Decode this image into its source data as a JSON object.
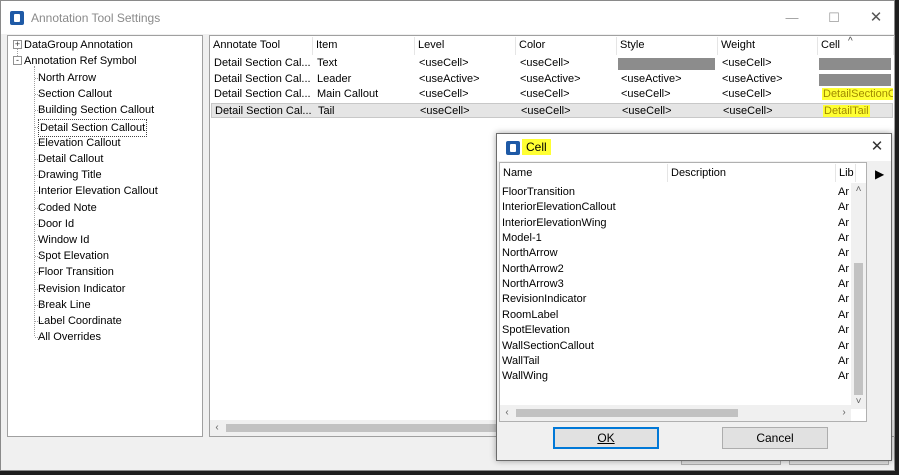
{
  "window": {
    "title": "Annotation Tool Settings"
  },
  "tree": {
    "root_items": [
      {
        "label": "DataGroup Annotation",
        "expander": "+"
      },
      {
        "label": "Annotation Ref Symbol",
        "expander": "-"
      }
    ],
    "children": [
      "North Arrow",
      "Section Callout",
      "Building Section Callout",
      "Detail Section Callout",
      "Elevation Callout",
      "Detail Callout",
      "Drawing Title",
      "Interior Elevation Callout",
      "Coded Note",
      "Door Id",
      "Window Id",
      "Spot Elevation",
      "Floor Transition",
      "Revision Indicator",
      "Break Line",
      "Label Coordinate",
      "All Overrides"
    ],
    "selected": "Detail Section Callout"
  },
  "grid": {
    "columns": [
      "Annotate Tool",
      "Item",
      "Level",
      "Color",
      "Style",
      "Weight",
      "Cell"
    ],
    "sort_indicator": "^",
    "rows": [
      {
        "tool": "Detail Section Cal...",
        "item": "Text",
        "level": "<useCell>",
        "color": "<useCell>",
        "style": "",
        "weight": "<useCell>",
        "cell": ""
      },
      {
        "tool": "Detail Section Cal...",
        "item": "Leader",
        "level": "<useActive>",
        "color": "<useActive>",
        "style": "<useActive>",
        "weight": "<useActive>",
        "cell": ""
      },
      {
        "tool": "Detail Section Cal...",
        "item": "Main Callout",
        "level": "<useCell>",
        "color": "<useCell>",
        "style": "<useCell>",
        "weight": "<useCell>",
        "cell": "DetailSectionC"
      },
      {
        "tool": "Detail Section Cal...",
        "item": "Tail",
        "level": "<useCell>",
        "color": "<useCell>",
        "style": "<useCell>",
        "weight": "<useCell>",
        "cell": "DetailTail"
      }
    ],
    "highlight_color": "#ffff33",
    "row_selected_color": "#e5e5e5"
  },
  "cell_dialog": {
    "title": "Cell",
    "close_icon": "close-icon",
    "columns": [
      "Name",
      "Description",
      "Lib"
    ],
    "items": [
      {
        "name": "FloorTransition",
        "lib": "Ar"
      },
      {
        "name": "InteriorElevationCallout",
        "lib": "Ar"
      },
      {
        "name": "InteriorElevationWing",
        "lib": "Ar"
      },
      {
        "name": "Model-1",
        "lib": "Ar"
      },
      {
        "name": "NorthArrow",
        "lib": "Ar"
      },
      {
        "name": "NorthArrow2",
        "lib": "Ar"
      },
      {
        "name": "NorthArrow3",
        "lib": "Ar"
      },
      {
        "name": "RevisionIndicator",
        "lib": "Ar"
      },
      {
        "name": "RoomLabel",
        "lib": "Ar"
      },
      {
        "name": "SpotElevation",
        "lib": "Ar"
      },
      {
        "name": "WallSectionCallout",
        "lib": "Ar"
      },
      {
        "name": "WallTail",
        "lib": "Ar"
      },
      {
        "name": "WallWing",
        "lib": "Ar"
      }
    ],
    "ok_label": "OK",
    "cancel_label": "Cancel",
    "accent_color": "#0078d7"
  }
}
